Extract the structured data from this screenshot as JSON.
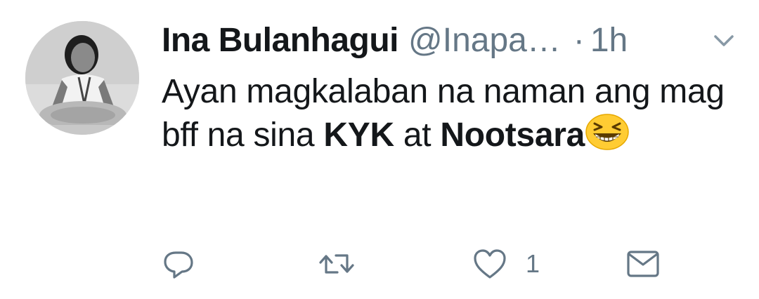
{
  "tweet": {
    "author": {
      "display_name": "Ina Bulanhagui",
      "handle": "@Inapa…",
      "avatar_icon": "profile-photo"
    },
    "separator": "·",
    "time": "1h",
    "text": {
      "part1": "Ayan magkalaban na naman ang mag bff na sina ",
      "bold1": "KYK",
      "part2": " at ",
      "bold2": "Nootsara",
      "emoji_name": "grinning-squinting-face-emoji"
    },
    "actions": {
      "reply_icon": "reply-icon",
      "retweet_icon": "retweet-icon",
      "like_icon": "heart-icon",
      "like_count": "1",
      "dm_icon": "envelope-icon"
    },
    "colors": {
      "text": "#14171a",
      "secondary": "#657786",
      "emoji": "#ffcc33"
    }
  }
}
